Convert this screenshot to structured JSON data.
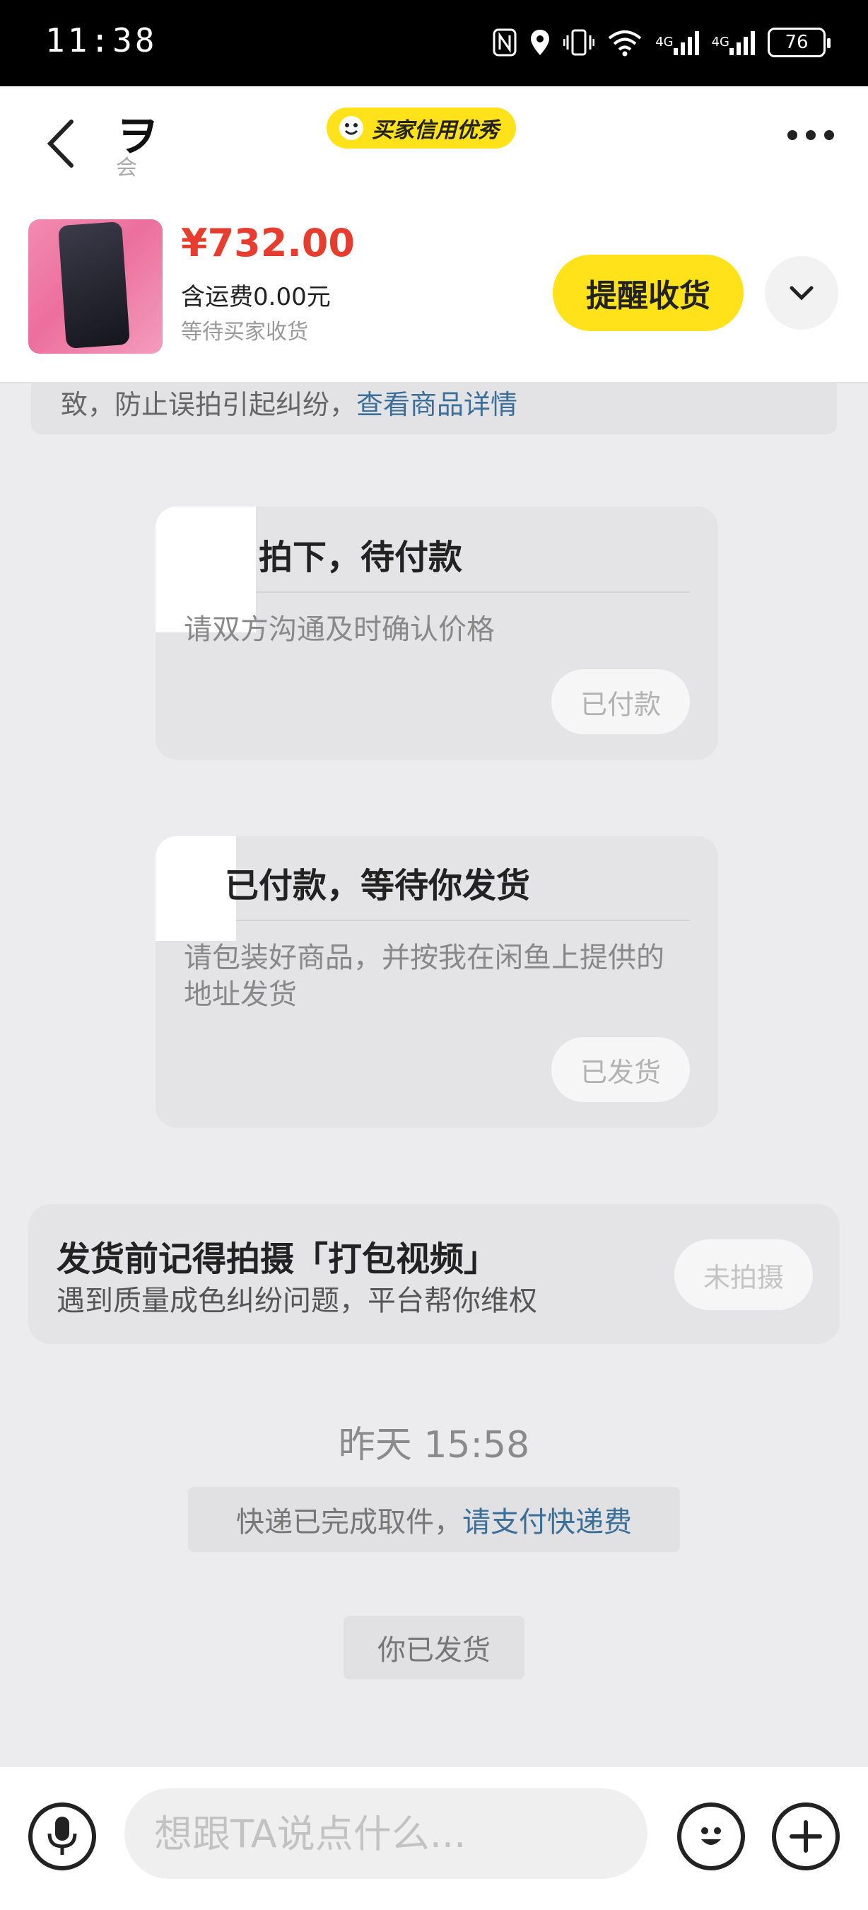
{
  "status_bar": {
    "time": "11:38",
    "network_1": "4G",
    "network_2": "4G",
    "battery": "76"
  },
  "header": {
    "partner_name": "ヲ",
    "partner_sub": "会",
    "credit_badge": "买家信用优秀",
    "accent_color": "#ffe21a"
  },
  "product": {
    "price": "¥732.00",
    "shipping": "含运费0.00元",
    "status": "等待买家收货",
    "remind_button": "提醒收货"
  },
  "messages": {
    "notice_text": "致，防止误拍引起纠纷，",
    "notice_link": "查看商品详情",
    "card1": {
      "title": "拍下，待付款",
      "desc": "请双方沟通及时确认价格",
      "action": "已付款"
    },
    "card2": {
      "title": "已付款，等待你发货",
      "desc": "请包装好商品，并按我在闲鱼上提供的地址发货",
      "action": "已发货"
    },
    "pack_card": {
      "title": "发货前记得拍摄「打包视频」",
      "subtitle": "遇到质量成色纠纷问题，平台帮你维权",
      "action": "未拍摄"
    },
    "timestamp": "昨天 15:58",
    "sys1_text": "快递已完成取件，",
    "sys1_link": "请支付快递费",
    "sys2_text": "你已发货"
  },
  "input_bar": {
    "placeholder": "想跟TA说点什么..."
  }
}
